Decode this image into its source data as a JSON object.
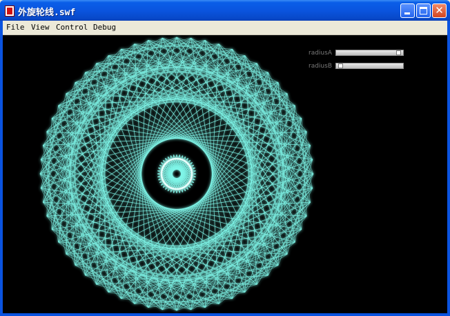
{
  "window": {
    "title": "外旋轮线.swf"
  },
  "menu": [
    "File",
    "View",
    "Control",
    "Debug"
  ],
  "sliders": [
    {
      "label": "radiusA",
      "fraction": 0.97
    },
    {
      "label": "radiusB",
      "fraction": 0.03
    }
  ],
  "epicycloid": {
    "stroke_color": "#7ff5e8",
    "glow_color": "#2fd6c8"
  },
  "icons": [
    "flash-app-icon",
    "minimize-icon",
    "maximize-icon",
    "close-icon"
  ]
}
